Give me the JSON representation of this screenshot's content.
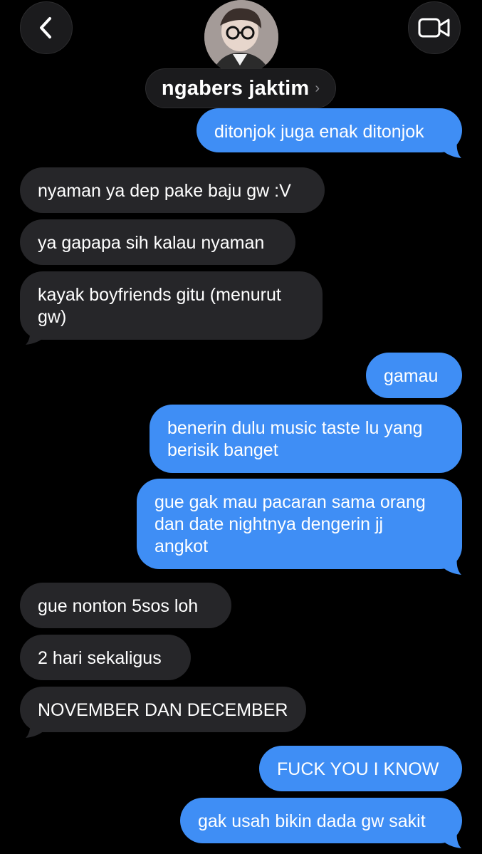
{
  "header": {
    "contact_name": "ngabers jaktim",
    "back_icon": "chevron-left-icon",
    "video_icon": "video-camera-icon",
    "name_chevron": "›"
  },
  "colors": {
    "sent_bubble": "#3f8ef5",
    "received_bubble": "#262629",
    "background": "#000000"
  },
  "messages": [
    {
      "text": "ditonjok juga enak ditonjok",
      "sender": "me"
    },
    {
      "text": "nyaman ya dep pake baju gw :V",
      "sender": "them"
    },
    {
      "text": "ya gapapa sih kalau nyaman",
      "sender": "them"
    },
    {
      "text": "kayak boyfriends gitu (menurut\ngw)",
      "sender": "them"
    },
    {
      "text": "gamau",
      "sender": "me"
    },
    {
      "text": "benerin dulu music taste lu yang\nberisik banget",
      "sender": "me"
    },
    {
      "text": "gue gak mau pacaran sama orang\ndan date nightnya dengerin jj\nangkot",
      "sender": "me"
    },
    {
      "text": "gue nonton 5sos loh",
      "sender": "them"
    },
    {
      "text": "2 hari sekaligus",
      "sender": "them"
    },
    {
      "text": "NOVEMBER DAN DECEMBER",
      "sender": "them"
    },
    {
      "text": "FUCK YOU I KNOW",
      "sender": "me"
    },
    {
      "text": "gak usah bikin dada gw sakit",
      "sender": "me"
    }
  ]
}
